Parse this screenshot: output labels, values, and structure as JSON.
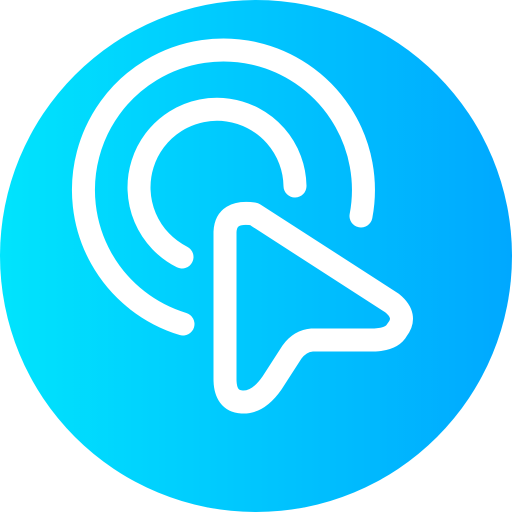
{
  "icon": {
    "name": "click-pointer-icon",
    "description_semantic": "tap-gesture",
    "colors": {
      "gradient_start": "#00E4FD",
      "gradient_end": "#00A8FF",
      "glyph": "#FFFFFF"
    },
    "parts": [
      "background-circle",
      "outer-ripple-arc",
      "inner-ripple-arc",
      "cursor-arrow"
    ]
  }
}
